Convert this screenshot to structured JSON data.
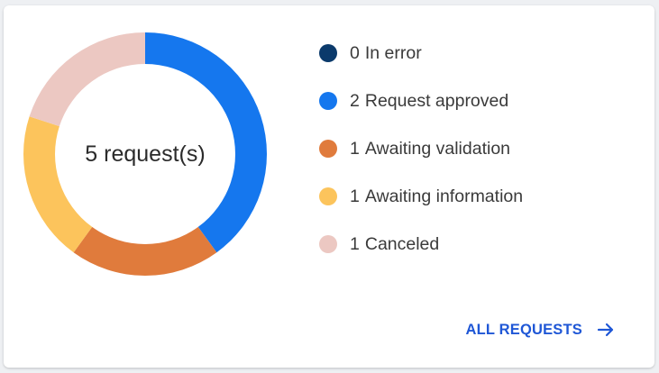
{
  "summary": {
    "center_label": "5 request(s)"
  },
  "legend": [
    {
      "count": "0",
      "label": "In error",
      "color": "#0b3a6b"
    },
    {
      "count": "2",
      "label": "Request approved",
      "color": "#1577ee"
    },
    {
      "count": "1",
      "label": "Awaiting validation",
      "color": "#e07b3c"
    },
    {
      "count": "1",
      "label": "Awaiting information",
      "color": "#fcc45c"
    },
    {
      "count": "1",
      "label": "Canceled",
      "color": "#ecc8c2"
    }
  ],
  "chart_data": {
    "type": "pie",
    "categories": [
      "In error",
      "Request approved",
      "Awaiting validation",
      "Awaiting information",
      "Canceled"
    ],
    "values": [
      0,
      2,
      1,
      1,
      1
    ],
    "colors": [
      "#0b3a6b",
      "#1577ee",
      "#e07b3c",
      "#fcc45c",
      "#ecc8c2"
    ]
  },
  "footer": {
    "link_label": "ALL REQUESTS",
    "link_icon": "arrow-right-icon",
    "link_color": "#1f57d6"
  }
}
